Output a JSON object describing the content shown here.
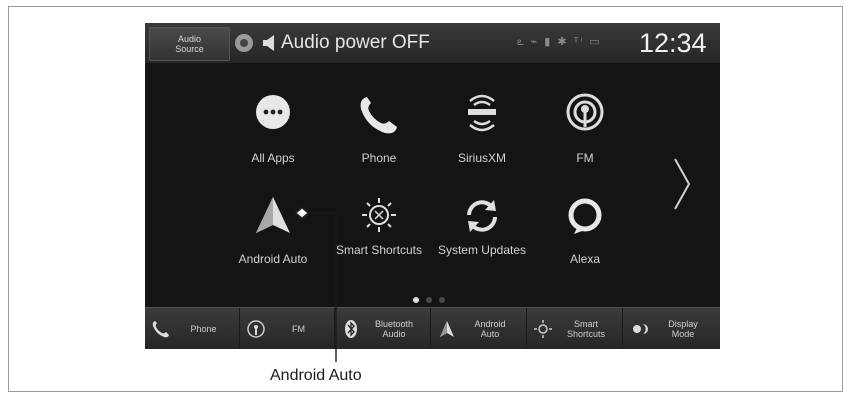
{
  "status_bar": {
    "audio_source_label": "Audio\nSource",
    "power_text": "Audio power OFF",
    "status_icons_text": "ఽ ⌁ ▮ ✱ ᵀⁱ ▭",
    "clock": "12:34"
  },
  "apps": [
    {
      "label": "All Apps",
      "icon": "all-apps-icon"
    },
    {
      "label": "Phone",
      "icon": "phone-icon"
    },
    {
      "label": "SiriusXM",
      "icon": "siriusxm-icon"
    },
    {
      "label": "FM",
      "icon": "fm-radio-icon"
    },
    {
      "label": "Android Auto",
      "icon": "android-auto-icon"
    },
    {
      "label": "Smart\nShortcuts",
      "icon": "smart-shortcuts-icon"
    },
    {
      "label": "System\nUpdates",
      "icon": "system-updates-icon"
    },
    {
      "label": "Alexa",
      "icon": "alexa-icon"
    }
  ],
  "pagination": {
    "pages": 3,
    "current": 1
  },
  "dock": [
    {
      "label": "Phone",
      "icon": "phone-icon"
    },
    {
      "label": "FM",
      "icon": "fm-radio-icon"
    },
    {
      "label": "Bluetooth\nAudio",
      "icon": "bluetooth-icon"
    },
    {
      "label": "Android\nAuto",
      "icon": "android-auto-icon"
    },
    {
      "label": "Smart\nShortcuts",
      "icon": "smart-shortcuts-icon"
    },
    {
      "label": "Display\nMode",
      "icon": "display-mode-icon"
    }
  ],
  "callout": {
    "label": "Android Auto"
  }
}
